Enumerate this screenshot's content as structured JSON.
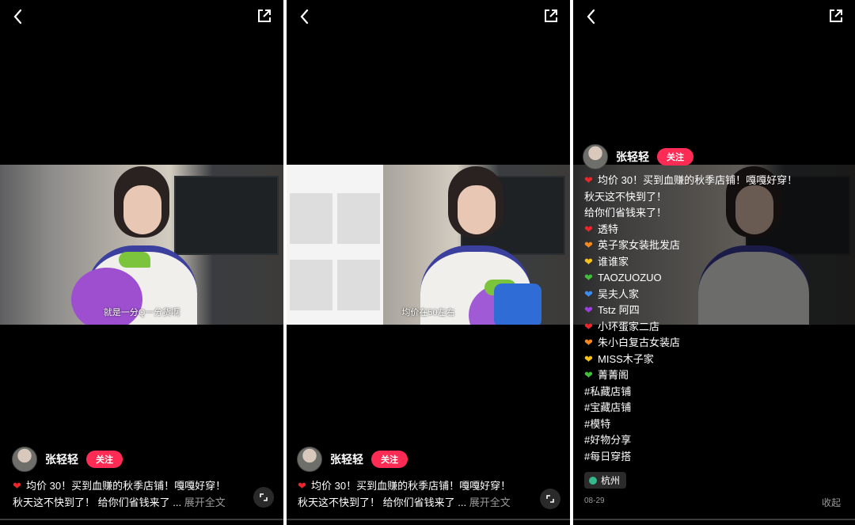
{
  "colors": {
    "follow_bg": "#fe2c55",
    "background": "#000000",
    "muted": "#9a9a9a"
  },
  "author": {
    "name": "张轻轻",
    "follow_label": "关注"
  },
  "panel1": {
    "caption": "就是一分Q一分货啊",
    "desc_line1": "均价 30！买到血赚的秋季店铺！嘎嘎好穿！",
    "desc_line2": "秋天这不快到了！ 给你们省钱来了 ...",
    "expand_label": "展开全文"
  },
  "panel2": {
    "caption": "均价在50左右",
    "desc_line1": "均价 30！买到血赚的秋季店铺！嘎嘎好穿！",
    "desc_line2": "秋天这不快到了！ 给你们省钱来了 ...",
    "expand_label": "展开全文"
  },
  "panel3": {
    "lines": [
      {
        "icon": "red-heart-icon",
        "color": "#e8262c",
        "text": "均价 30！买到血赚的秋季店铺！嘎嘎好穿！"
      },
      {
        "icon": "",
        "color": "",
        "text": "秋天这不快到了！"
      },
      {
        "icon": "",
        "color": "",
        "text": "给你们省钱来了！"
      },
      {
        "icon": "red-heart-icon",
        "color": "#e8262c",
        "text": "透特"
      },
      {
        "icon": "orange-heart-icon",
        "color": "#f5891f",
        "text": "英子家女装批发店"
      },
      {
        "icon": "yellow-heart-icon",
        "color": "#f7c21c",
        "text": "谁谁家"
      },
      {
        "icon": "green-heart-icon",
        "color": "#3fbf3a",
        "text": "TAOZUOZUO"
      },
      {
        "icon": "blue-heart-icon",
        "color": "#3a8ef0",
        "text": "吴夫人家"
      },
      {
        "icon": "purple-heart-icon",
        "color": "#9b3fe0",
        "text": "Tstz 阿四"
      },
      {
        "icon": "red-heart-icon",
        "color": "#e8262c",
        "text": "小环蛋家二店"
      },
      {
        "icon": "orange-heart-icon",
        "color": "#f5891f",
        "text": "朱小白复古女装店"
      },
      {
        "icon": "yellow-heart-icon",
        "color": "#f7c21c",
        "text": "MISS木子家"
      },
      {
        "icon": "green-heart-icon",
        "color": "#3fbf3a",
        "text": "菁菁阁"
      },
      {
        "icon": "",
        "color": "",
        "text": "#私藏店铺"
      },
      {
        "icon": "",
        "color": "",
        "text": "#宝藏店铺"
      },
      {
        "icon": "",
        "color": "",
        "text": "#模特"
      },
      {
        "icon": "",
        "color": "",
        "text": "#好物分享"
      },
      {
        "icon": "",
        "color": "",
        "text": "#每日穿搭"
      }
    ],
    "location": "杭州",
    "date": "08-29",
    "collapse_label": "收起"
  }
}
